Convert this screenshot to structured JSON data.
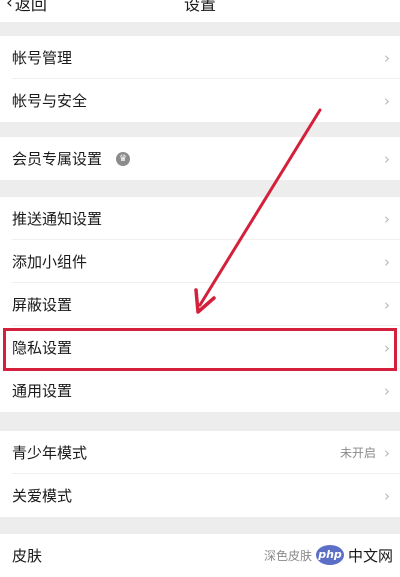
{
  "header": {
    "back_label": "返回",
    "title": "设置"
  },
  "groups": {
    "account": {
      "items": [
        {
          "label": "帐号管理"
        },
        {
          "label": "帐号与安全"
        }
      ]
    },
    "member": {
      "items": [
        {
          "label": "会员专属设置",
          "icon": "vip-crown-icon"
        }
      ]
    },
    "settings": {
      "items": [
        {
          "label": "推送通知设置"
        },
        {
          "label": "添加小组件"
        },
        {
          "label": "屏蔽设置"
        },
        {
          "label": "隐私设置"
        },
        {
          "label": "通用设置"
        }
      ]
    },
    "modes": {
      "items": [
        {
          "label": "青少年模式",
          "value": "未开启"
        },
        {
          "label": "关爱模式"
        }
      ]
    },
    "appearance": {
      "items": [
        {
          "label": "皮肤",
          "value": "深色皮肤"
        }
      ]
    }
  },
  "watermark": {
    "badge": "php",
    "text": "中文网"
  },
  "annotation_color": "#d4203b"
}
